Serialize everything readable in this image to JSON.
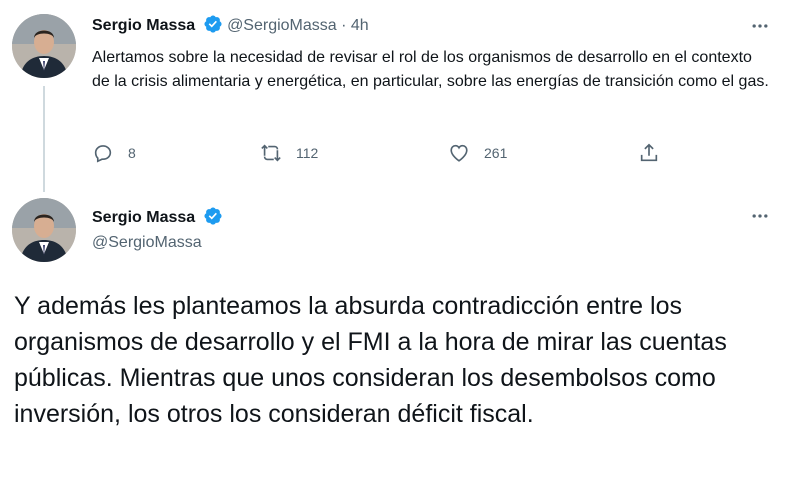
{
  "tweet1": {
    "author_name": "Sergio Massa",
    "handle": "@SergioMassa",
    "separator": " · ",
    "time": "4h",
    "text": "Alertamos sobre la necesidad de revisar el rol de los organismos de desarrollo en el contexto de la crisis alimentaria y energética, en particular, sobre las energías de transición como el gas.",
    "replies": "8",
    "retweets": "112",
    "likes": "261"
  },
  "tweet2": {
    "author_name": "Sergio Massa",
    "handle": "@SergioMassa",
    "text": "Y además les planteamos la absurda contradicción entre los organismos de desarrollo y el FMI a la hora de mirar las cuentas públicas. Mientras que unos consideran los desembolsos como inversión, los otros los consideran déficit fiscal."
  },
  "colors": {
    "verified": "#1d9bf0",
    "secondary_text": "#536471",
    "primary_text": "#0f1419",
    "thread_line": "#cfd9de"
  },
  "icons": {
    "verified": "verified-badge-icon",
    "more": "more-horizontal-icon",
    "reply": "reply-icon",
    "retweet": "retweet-icon",
    "like": "heart-icon",
    "share": "share-icon"
  }
}
